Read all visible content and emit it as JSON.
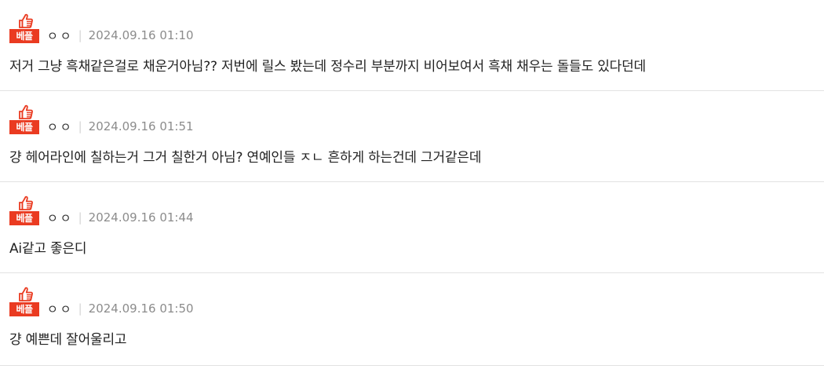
{
  "colors": {
    "best_badge": "#ea3b21",
    "meta_text": "#8c8c8c",
    "body_text": "#222222",
    "divider": "#e2e2e2"
  },
  "comments": [
    {
      "badge_label": "베플",
      "badge_icon": "thumbs-up-icon",
      "author": "ㅇㅇ",
      "separator": "|",
      "date": "2024.09.16 01:10",
      "text": "저거 그냥 흑채같은걸로 채운거아님?? 저번에 릴스 봤는데 정수리 부분까지 비어보여서 흑채 채우는 돌들도 있다던데"
    },
    {
      "badge_label": "베플",
      "badge_icon": "thumbs-up-icon",
      "author": "ㅇㅇ",
      "separator": "|",
      "date": "2024.09.16 01:51",
      "text": "걍 헤어라인에 칠하는거 그거 칠한거 아님? 연예인들 ㅈㄴ 흔하게 하는건데 그거같은데"
    },
    {
      "badge_label": "베플",
      "badge_icon": "thumbs-up-icon",
      "author": "ㅇㅇ",
      "separator": "|",
      "date": "2024.09.16 01:44",
      "text": "Ai같고 좋은디"
    },
    {
      "badge_label": "베플",
      "badge_icon": "thumbs-up-icon",
      "author": "ㅇㅇ",
      "separator": "|",
      "date": "2024.09.16 01:50",
      "text": "걍 예쁜데 잘어울리고"
    }
  ]
}
